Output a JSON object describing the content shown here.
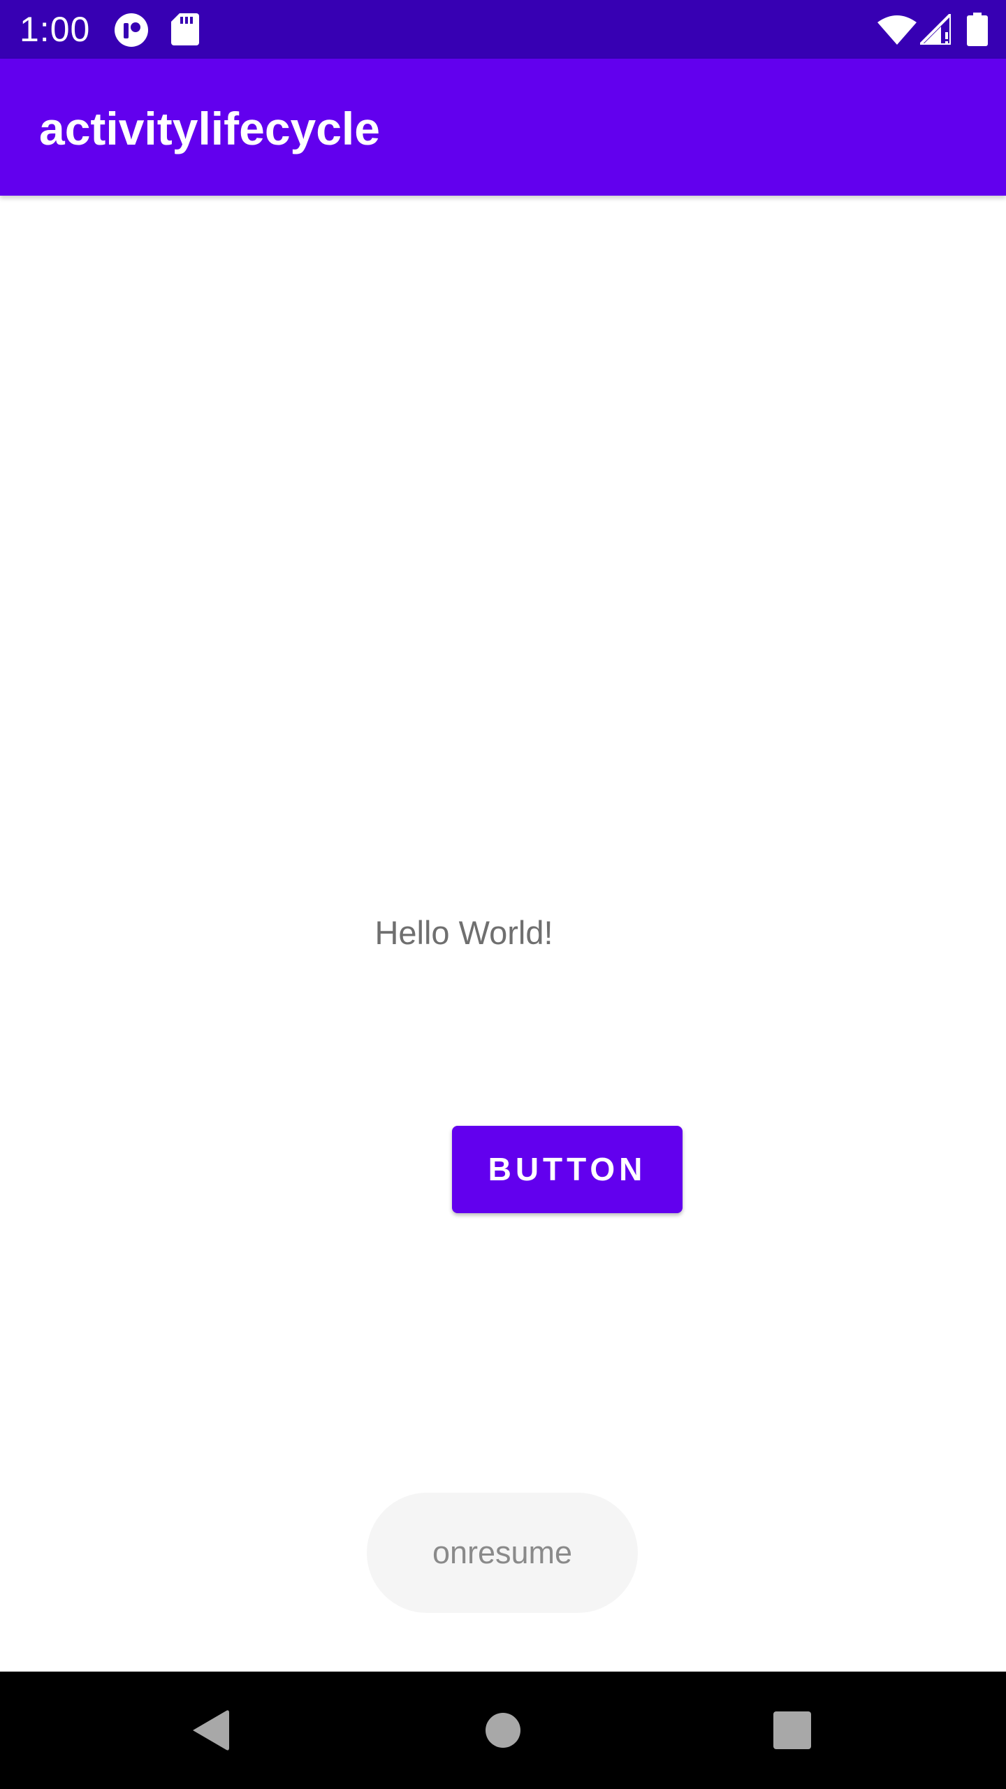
{
  "status_bar": {
    "time": "1:00",
    "background": "#3700B3",
    "icons": [
      "tracker-icon",
      "sd-card-icon",
      "wifi-icon",
      "cell-signal-icon",
      "battery-icon"
    ]
  },
  "app_bar": {
    "title": "activitylifecycle",
    "background": "#6200EE"
  },
  "main": {
    "hello_text": "Hello World!",
    "button_label": "BUTTON",
    "button_color": "#6200EE"
  },
  "toast": {
    "message": "onresume"
  },
  "nav_bar": {
    "buttons": [
      "back-icon",
      "home-icon",
      "recents-icon"
    ],
    "background": "#000000"
  }
}
